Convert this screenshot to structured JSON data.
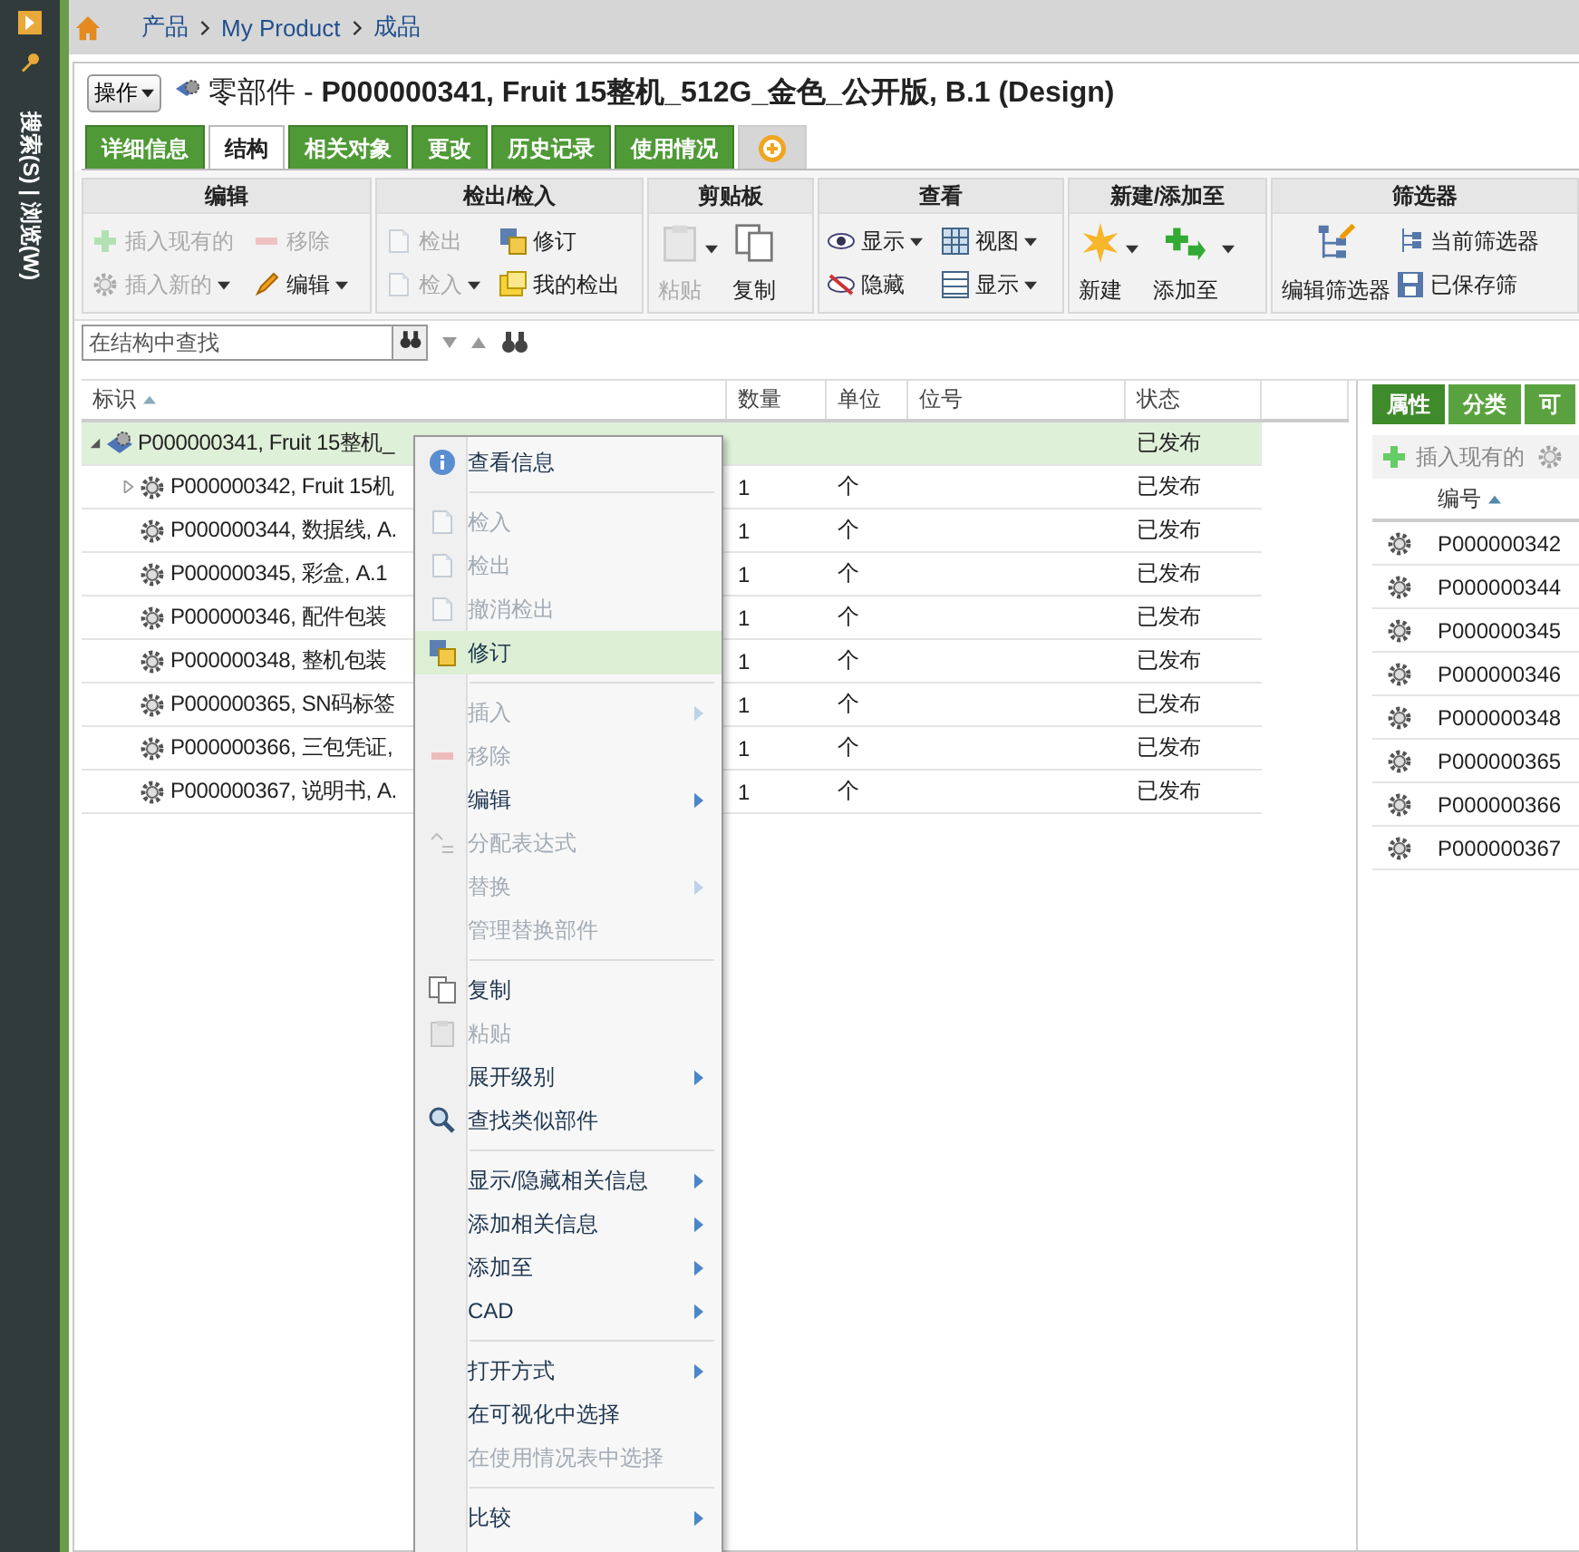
{
  "sidebar": {
    "label": "搜索(S) | 浏览(W)"
  },
  "breadcrumb": [
    "产品",
    "My Product",
    "成品"
  ],
  "header": {
    "actions": "操作",
    "title": "零部件 - **P000000341, Fruit 15整机_512G_金色_公开版, B.1 (Design)**"
  },
  "tabs": [
    {
      "label": "详细信息",
      "selected": false
    },
    {
      "label": "结构",
      "selected": true
    },
    {
      "label": "相关对象",
      "selected": false
    },
    {
      "label": "更改",
      "selected": false
    },
    {
      "label": "历史记录",
      "selected": false
    },
    {
      "label": "使用情况",
      "selected": false
    }
  ],
  "toolbar": [
    {
      "title": "编辑",
      "buttons": [
        {
          "label": "插入现有的",
          "disabled": true,
          "dropdown": false,
          "kind": "small"
        },
        {
          "label": "移除",
          "disabled": true,
          "dropdown": false,
          "kind": "small"
        },
        {
          "label": "插入新的",
          "disabled": true,
          "dropdown": true,
          "kind": "small"
        },
        {
          "label": "编辑",
          "disabled": false,
          "dropdown": true,
          "kind": "small"
        }
      ]
    },
    {
      "title": "检出/检入",
      "buttons": [
        {
          "label": "检出",
          "disabled": true,
          "dropdown": false,
          "kind": "small"
        },
        {
          "label": "修订",
          "disabled": false,
          "dropdown": false,
          "kind": "small"
        },
        {
          "label": "检入",
          "disabled": true,
          "dropdown": true,
          "kind": "small"
        },
        {
          "label": "我的检出",
          "disabled": false,
          "dropdown": false,
          "kind": "small"
        }
      ]
    },
    {
      "title": "剪贴板",
      "buttons": [
        {
          "label": "粘贴",
          "disabled": true,
          "dropdown": true,
          "kind": "large"
        },
        {
          "label": "复制",
          "disabled": false,
          "dropdown": false,
          "kind": "large"
        }
      ]
    },
    {
      "title": "查看",
      "buttons": [
        {
          "label": "显示",
          "disabled": false,
          "dropdown": true,
          "kind": "small"
        },
        {
          "label": "视图",
          "disabled": false,
          "dropdown": true,
          "kind": "small"
        },
        {
          "label": "隐藏",
          "disabled": false,
          "dropdown": false,
          "kind": "small"
        },
        {
          "label": "显示",
          "disabled": false,
          "dropdown": true,
          "kind": "small"
        }
      ]
    },
    {
      "title": "新建/添加至",
      "buttons": [
        {
          "label": "新建",
          "disabled": false,
          "dropdown": true,
          "kind": "large"
        },
        {
          "label": "添加至",
          "disabled": false,
          "dropdown": true,
          "kind": "large"
        }
      ]
    },
    {
      "title": "筛选器",
      "buttons": [
        {
          "label": "编辑筛选器",
          "disabled": false,
          "dropdown": false,
          "kind": "large"
        },
        {
          "label": "当前筛选器",
          "disabled": false,
          "dropdown": false,
          "kind": "small"
        },
        {
          "label": "已保存筛",
          "disabled": false,
          "dropdown": false,
          "kind": "small"
        }
      ]
    }
  ],
  "search": {
    "placeholder": "在结构中查找"
  },
  "table": {
    "columns": [
      "标识",
      "数量",
      "单位",
      "位号",
      "状态"
    ],
    "rows": [
      {
        "name": "P000000341, Fruit 15整机_",
        "state": "已发布",
        "selected": true,
        "expanded": true,
        "kind": "assembly"
      },
      {
        "name": "P000000342, Fruit 15机",
        "quantity": "1",
        "unit": "个",
        "state": "已发布",
        "selected": false,
        "expanded": false,
        "kind": "part"
      },
      {
        "name": "P000000344, 数据线, A.",
        "quantity": "1",
        "unit": "个",
        "state": "已发布",
        "selected": false,
        "kind": "part"
      },
      {
        "name": "P000000345, 彩盒, A.1",
        "quantity": "1",
        "unit": "个",
        "state": "已发布",
        "selected": false,
        "kind": "part"
      },
      {
        "name": "P000000346, 配件包装",
        "quantity": "1",
        "unit": "个",
        "state": "已发布",
        "selected": false,
        "kind": "part"
      },
      {
        "name": "P000000348, 整机包装",
        "quantity": "1",
        "unit": "个",
        "state": "已发布",
        "selected": false,
        "kind": "part"
      },
      {
        "name": "P000000365, SN码标签",
        "quantity": "1",
        "unit": "个",
        "state": "已发布",
        "selected": false,
        "kind": "part"
      },
      {
        "name": "P000000366, 三包凭证,",
        "quantity": "1",
        "unit": "个",
        "state": "已发布",
        "selected": false,
        "kind": "part"
      },
      {
        "name": "P000000367, 说明书, A.",
        "quantity": "1",
        "unit": "个",
        "state": "已发布",
        "selected": false,
        "kind": "part"
      }
    ]
  },
  "context_menu": [
    {
      "label": "查看信息",
      "disabled": false,
      "submenu": false,
      "selected": false
    },
    {
      "kind": "separator"
    },
    {
      "label": "检入",
      "disabled": true,
      "submenu": false,
      "selected": false
    },
    {
      "label": "检出",
      "disabled": true,
      "submenu": false,
      "selected": false
    },
    {
      "label": "撤消检出",
      "disabled": true,
      "submenu": false,
      "selected": false
    },
    {
      "label": "修订",
      "disabled": false,
      "submenu": false,
      "selected": true
    },
    {
      "kind": "separator"
    },
    {
      "label": "插入",
      "disabled": true,
      "submenu": true,
      "selected": false
    },
    {
      "label": "移除",
      "disabled": true,
      "submenu": false,
      "selected": false
    },
    {
      "label": "编辑",
      "disabled": false,
      "submenu": true,
      "selected": false
    },
    {
      "label": "分配表达式",
      "disabled": true,
      "submenu": false,
      "selected": false
    },
    {
      "label": "替换",
      "disabled": true,
      "submenu": true,
      "selected": false
    },
    {
      "label": "管理替换部件",
      "disabled": true,
      "submenu": false,
      "selected": false
    },
    {
      "kind": "separator"
    },
    {
      "label": "复制",
      "disabled": false,
      "submenu": false,
      "selected": false
    },
    {
      "label": "粘贴",
      "disabled": true,
      "submenu": false,
      "selected": false
    },
    {
      "label": "展开级别",
      "disabled": false,
      "submenu": true,
      "selected": false
    },
    {
      "label": "查找类似部件",
      "disabled": false,
      "submenu": false,
      "selected": false
    },
    {
      "kind": "separator"
    },
    {
      "label": "显示/隐藏相关信息",
      "disabled": false,
      "submenu": true,
      "selected": false
    },
    {
      "label": "添加相关信息",
      "disabled": false,
      "submenu": true,
      "selected": false
    },
    {
      "label": "添加至",
      "disabled": false,
      "submenu": true,
      "selected": false
    },
    {
      "label": "CAD",
      "disabled": false,
      "submenu": true,
      "selected": false
    },
    {
      "kind": "separator"
    },
    {
      "label": "打开方式",
      "disabled": false,
      "submenu": true,
      "selected": false
    },
    {
      "label": "在可视化中选择",
      "disabled": false,
      "submenu": false,
      "selected": false
    },
    {
      "label": "在使用情况表中选择",
      "disabled": true,
      "submenu": false,
      "selected": false
    },
    {
      "kind": "separator"
    },
    {
      "label": "比较",
      "disabled": false,
      "submenu": true,
      "selected": false
    }
  ],
  "side_panel": {
    "tabs": [
      {
        "label": "属性",
        "selected": true
      },
      {
        "label": "分类",
        "selected": false
      },
      {
        "label": "可",
        "selected": false
      }
    ],
    "insert": {
      "label": "插入现有的",
      "disabled": true
    },
    "column": "编号",
    "rows": [
      "P000000342",
      "P000000344",
      "P000000345",
      "P000000346",
      "P000000348",
      "P000000365",
      "P000000366",
      "P000000367"
    ]
  }
}
